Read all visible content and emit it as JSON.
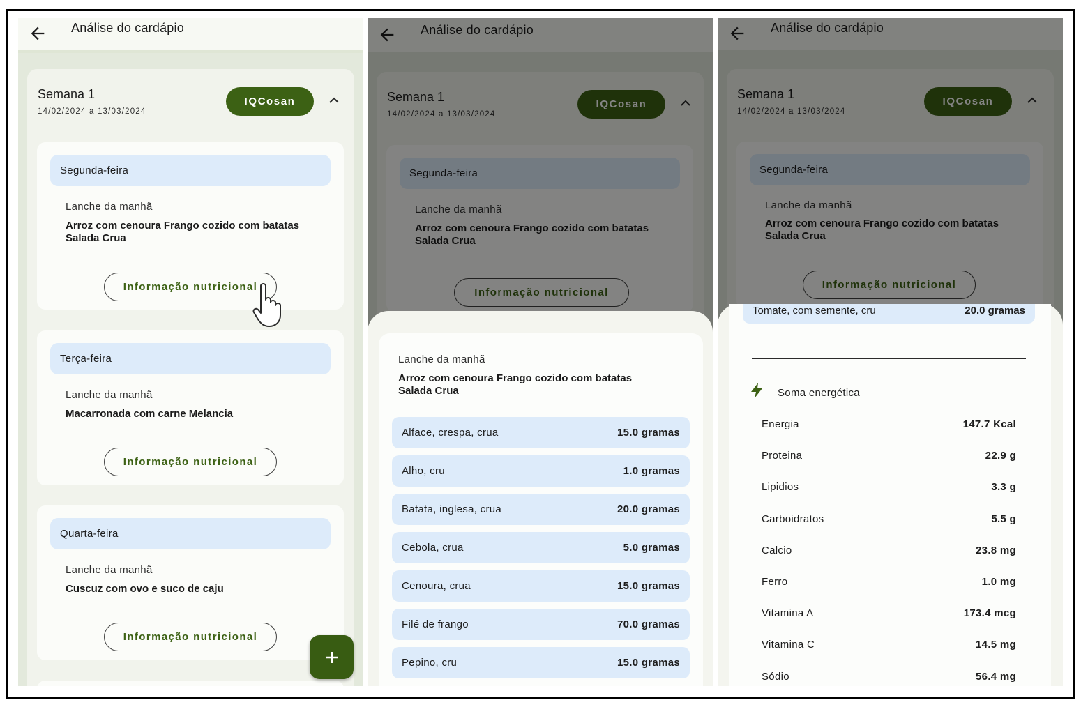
{
  "screens": [
    {
      "appbar": {
        "title": "Análise do cardápio"
      },
      "week": {
        "title": "Semana 1",
        "range": "14/02/2024 a 13/03/2024",
        "badge": "IQCosan"
      },
      "days": [
        {
          "day": "Segunda-feira",
          "meal": "Lanche da manhã",
          "description": "Arroz com cenoura Frango cozido com batatas Salada Crua",
          "button": "Informação nutricional"
        },
        {
          "day": "Terça-feira",
          "meal": "Lanche da manhã",
          "description": "Macarronada com carne Melancia",
          "button": "Informação nutricional"
        },
        {
          "day": "Quarta-feira",
          "meal": "Lanche da manhã",
          "description": "Cuscuz com ovo e suco de caju",
          "button": "Informação nutricional"
        }
      ],
      "fab": "+"
    },
    {
      "appbar": {
        "title": "Análise do cardápio"
      },
      "week": {
        "title": "Semana 1",
        "range": "14/02/2024 a 13/03/2024",
        "badge": "IQCosan"
      },
      "background_day": {
        "day": "Segunda-feira",
        "meal": "Lanche da manhã",
        "description": "Arroz com cenoura Frango cozido com batatas Salada Crua",
        "button": "Informação nutricional"
      },
      "sheet": {
        "meal": "Lanche da manhã",
        "description": "Arroz com cenoura Frango cozido com batatas Salada Crua",
        "ingredients": [
          {
            "name": "Alface, crespa, crua",
            "qty": "15.0 gramas"
          },
          {
            "name": "Alho, cru",
            "qty": "1.0 gramas"
          },
          {
            "name": "Batata, inglesa, crua",
            "qty": "20.0 gramas"
          },
          {
            "name": "Cebola, crua",
            "qty": "5.0 gramas"
          },
          {
            "name": "Cenoura, crua",
            "qty": "15.0 gramas"
          },
          {
            "name": "Filé de frango",
            "qty": "70.0 gramas"
          },
          {
            "name": "Pepino, cru",
            "qty": "15.0 gramas"
          }
        ]
      }
    },
    {
      "appbar": {
        "title": "Análise do cardápio"
      },
      "week": {
        "title": "Semana 1",
        "range": "14/02/2024 a 13/03/2024",
        "badge": "IQCosan"
      },
      "background_day": {
        "day": "Segunda-feira",
        "meal": "Lanche da manhã",
        "description": "Arroz com cenoura Frango cozido com batatas Salada Crua",
        "button": "Informação nutricional"
      },
      "sheet": {
        "last_ingredient": {
          "name": "Tomate, com semente, cru",
          "qty": "20.0 gramas"
        },
        "energy_title": "Soma energética",
        "nutrients": [
          {
            "name": "Energia",
            "value": "147.7 Kcal"
          },
          {
            "name": "Proteina",
            "value": "22.9 g"
          },
          {
            "name": "Lipidios",
            "value": "3.3 g"
          },
          {
            "name": "Carboidratos",
            "value": "5.5 g"
          },
          {
            "name": "Calcio",
            "value": "23.8 mg"
          },
          {
            "name": "Ferro",
            "value": "1.0 mg"
          },
          {
            "name": "Vitamina A",
            "value": "173.4 mcg"
          },
          {
            "name": "Vitamina C",
            "value": "14.5 mg"
          },
          {
            "name": "Sódio",
            "value": "56.4 mg"
          }
        ]
      }
    }
  ],
  "colors": {
    "primary": "#3c6114",
    "chip": "#ddebfa",
    "background": "#e3e9dc"
  },
  "icons": [
    "back-arrow-icon",
    "chevron-up-icon",
    "plus-icon",
    "bolt-icon",
    "hand-pointer-icon"
  ]
}
